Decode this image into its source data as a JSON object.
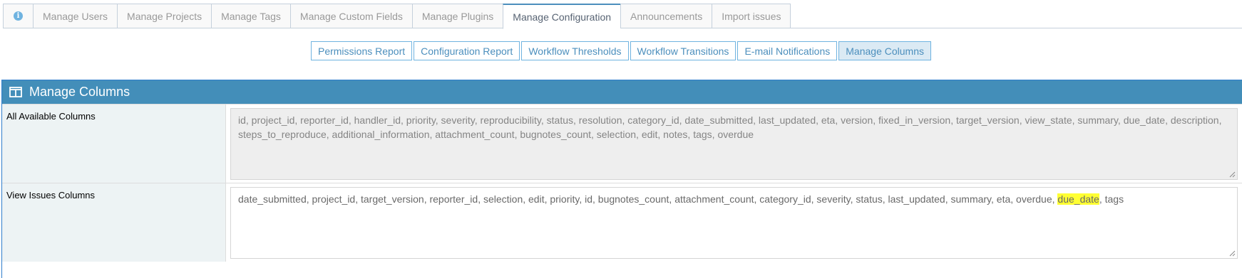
{
  "nav_tabs": [
    {
      "label": "Manage Users"
    },
    {
      "label": "Manage Projects"
    },
    {
      "label": "Manage Tags"
    },
    {
      "label": "Manage Custom Fields"
    },
    {
      "label": "Manage Plugins"
    },
    {
      "label": "Manage Configuration"
    },
    {
      "label": "Announcements"
    },
    {
      "label": "Import issues"
    }
  ],
  "info_icon": "info-circle-icon",
  "sub_nav": [
    {
      "label": "Permissions Report"
    },
    {
      "label": "Configuration Report"
    },
    {
      "label": "Workflow Thresholds"
    },
    {
      "label": "Workflow Transitions"
    },
    {
      "label": "E-mail Notifications"
    },
    {
      "label": "Manage Columns"
    }
  ],
  "widget": {
    "title": "Manage Columns",
    "icon": "columns-icon"
  },
  "all_columns": {
    "label": "All Available Columns",
    "value": "id, project_id, reporter_id, handler_id, priority, severity, reproducibility, status, resolution, category_id, date_submitted, last_updated, eta, version, fixed_in_version, target_version, view_state, summary, due_date, description, steps_to_reproduce, additional_information, attachment_count, bugnotes_count, selection, edit, notes, tags, overdue"
  },
  "view_columns": {
    "label": "View Issues Columns",
    "value_before": "date_submitted, project_id, target_version, reporter_id, selection, edit, priority, id, bugnotes_count, attachment_count, category_id, severity, status, last_updated, summary, eta, overdue, ",
    "value_highlight": "due_date",
    "value_after": ", tags"
  },
  "colors": {
    "header_bg": "#438eb9",
    "active_tab_border": "#4c8fbd",
    "highlight": "#ffff33"
  }
}
